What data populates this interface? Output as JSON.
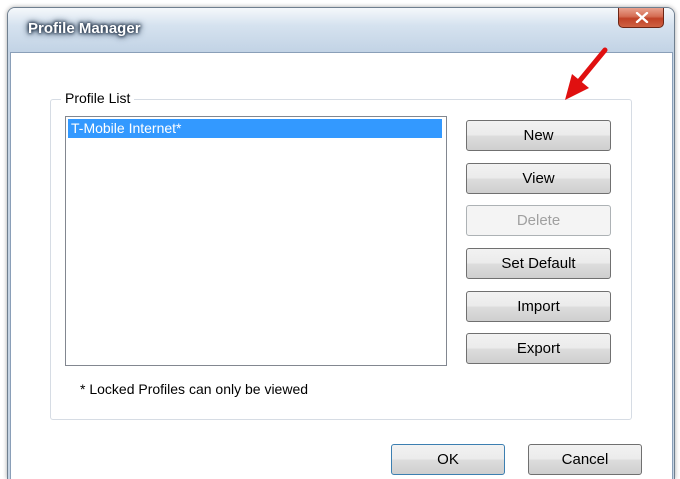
{
  "window": {
    "title": "Profile Manager"
  },
  "profile_list": {
    "group_label": "Profile List",
    "items": [
      "T-Mobile Internet*"
    ],
    "selected_index": 0
  },
  "buttons": {
    "new": "New",
    "view": "View",
    "delete": "Delete",
    "set_default": "Set Default",
    "import": "Import",
    "export": "Export",
    "ok": "OK",
    "cancel": "Cancel"
  },
  "note": "* Locked Profiles can only be viewed",
  "colors": {
    "selection": "#3399ff",
    "close_button": "#c9513a",
    "annotation_arrow": "#e01010"
  },
  "icons": {
    "close": "close-icon",
    "annotation": "red-arrow-icon"
  }
}
